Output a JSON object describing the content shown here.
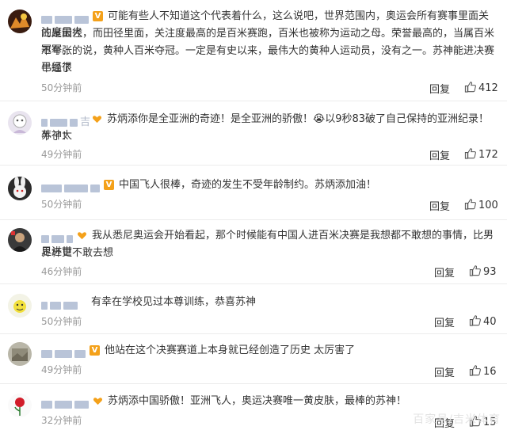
{
  "comments": [
    {
      "text_1": "可能有些人不知道这个代表着什么，这么说吧，世界范围内，奥运会所有赛事里面关注度最大",
      "text_2": "的是田径，而田径里面，关注度最高的是百米赛跑，百米也被称为运动之母。荣誉最高的，当属百米冠军。",
      "text_3": "不夸张的说，黄种人百米夺冠。一定是有史以来，最伟大的黄种人运动员，没有之一。苏神能进决赛已经很",
      "text_4": "牛逼了",
      "time": "50分钟前",
      "reply": "回复",
      "likes": "412"
    },
    {
      "text_1": "苏炳添你是全亚洲的奇迹！是全亚洲的骄傲！😭以9秒83破了自己保持的亚洲纪录！苏神太",
      "text_2": "牛了！",
      "name_suffix": "吉",
      "time": "49分钟前",
      "reply": "回复",
      "likes": "172"
    },
    {
      "text_1": "中国飞人很棒，奇迹的发生不受年龄制约。苏炳添加油！",
      "time": "50分钟前",
      "reply": "回复",
      "likes": "100"
    },
    {
      "text_1": "我从悉尼奥运会开始看起，那个时候能有中国人进百米决赛是我想都不敢想的事情，比男足进世",
      "text_2": "界杯更不敢去想",
      "time": "46分钟前",
      "reply": "回复",
      "likes": "93"
    },
    {
      "text_1": "有幸在学校见过本尊训练，恭喜苏神",
      "time": "50分钟前",
      "reply": "回复",
      "likes": "40"
    },
    {
      "text_1": "他站在这个决赛赛道上本身就已经创造了历史 太厉害了",
      "time": "49分钟前",
      "reply": "回复",
      "likes": "16"
    },
    {
      "text_1": "苏炳添中国骄傲！亚洲飞人，奥运决赛唯一黄皮肤，最棒的苏神！",
      "time": "32分钟前",
      "reply": "回复",
      "likes": "15"
    }
  ],
  "badge_letter": "V",
  "watermark": "百家号/吉米体育",
  "icons": {
    "like": "thumbs-up-icon",
    "badge_v": "vip-badge-icon",
    "badge_heart": "heart-badge-icon"
  }
}
